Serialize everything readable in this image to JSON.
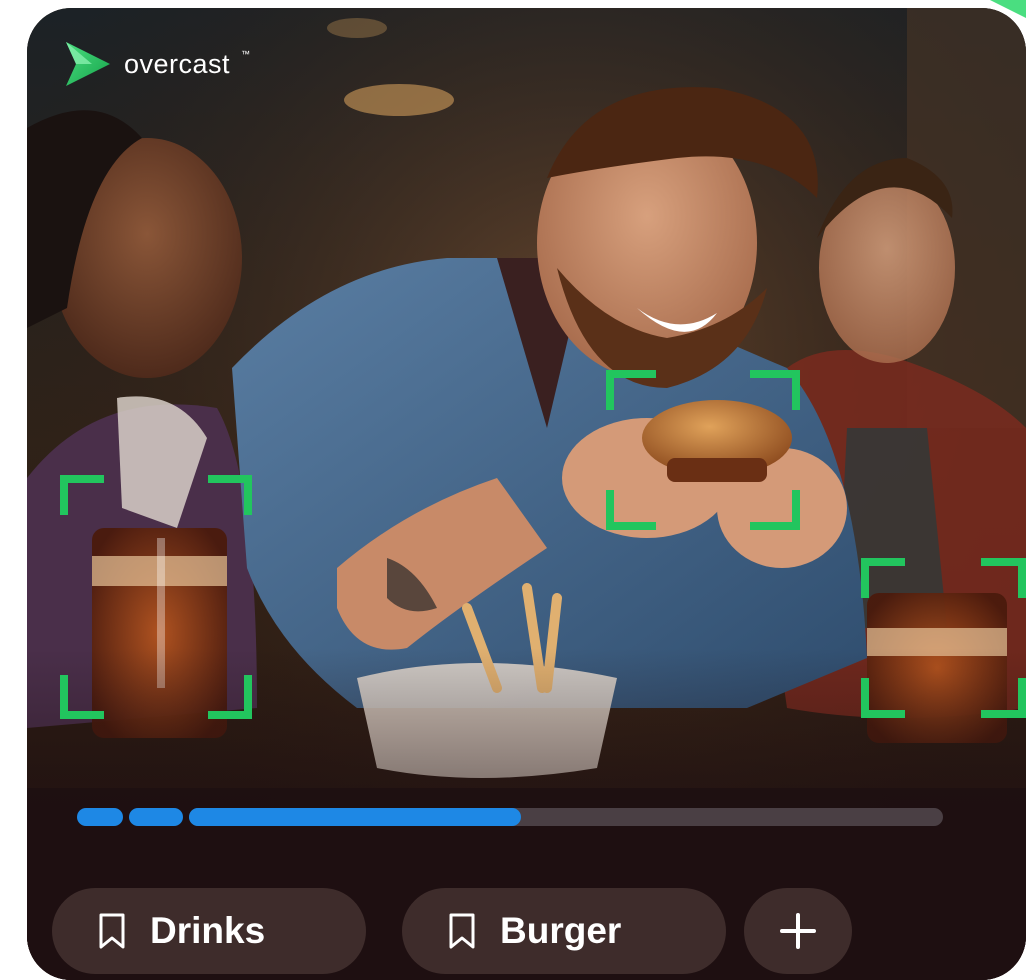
{
  "brand": {
    "logo_text": "overcast",
    "trademark": "™",
    "accent_color": "#22c55e"
  },
  "detection_frames": [
    {
      "label": "drink-left",
      "color": "#22c55e"
    },
    {
      "label": "burger",
      "color": "#22c55e"
    },
    {
      "label": "drink-right",
      "color": "#22c55e"
    }
  ],
  "progress": {
    "color_fill": "#1e88e5",
    "color_track": "#4a3f44",
    "segments_completed": 2,
    "current_segment_fraction": 0.44
  },
  "tags": [
    {
      "label": "Drinks",
      "icon": "bookmark-icon"
    },
    {
      "label": "Burger",
      "icon": "bookmark-icon"
    }
  ],
  "add_tag": {
    "label": "+",
    "icon": "plus-icon"
  }
}
